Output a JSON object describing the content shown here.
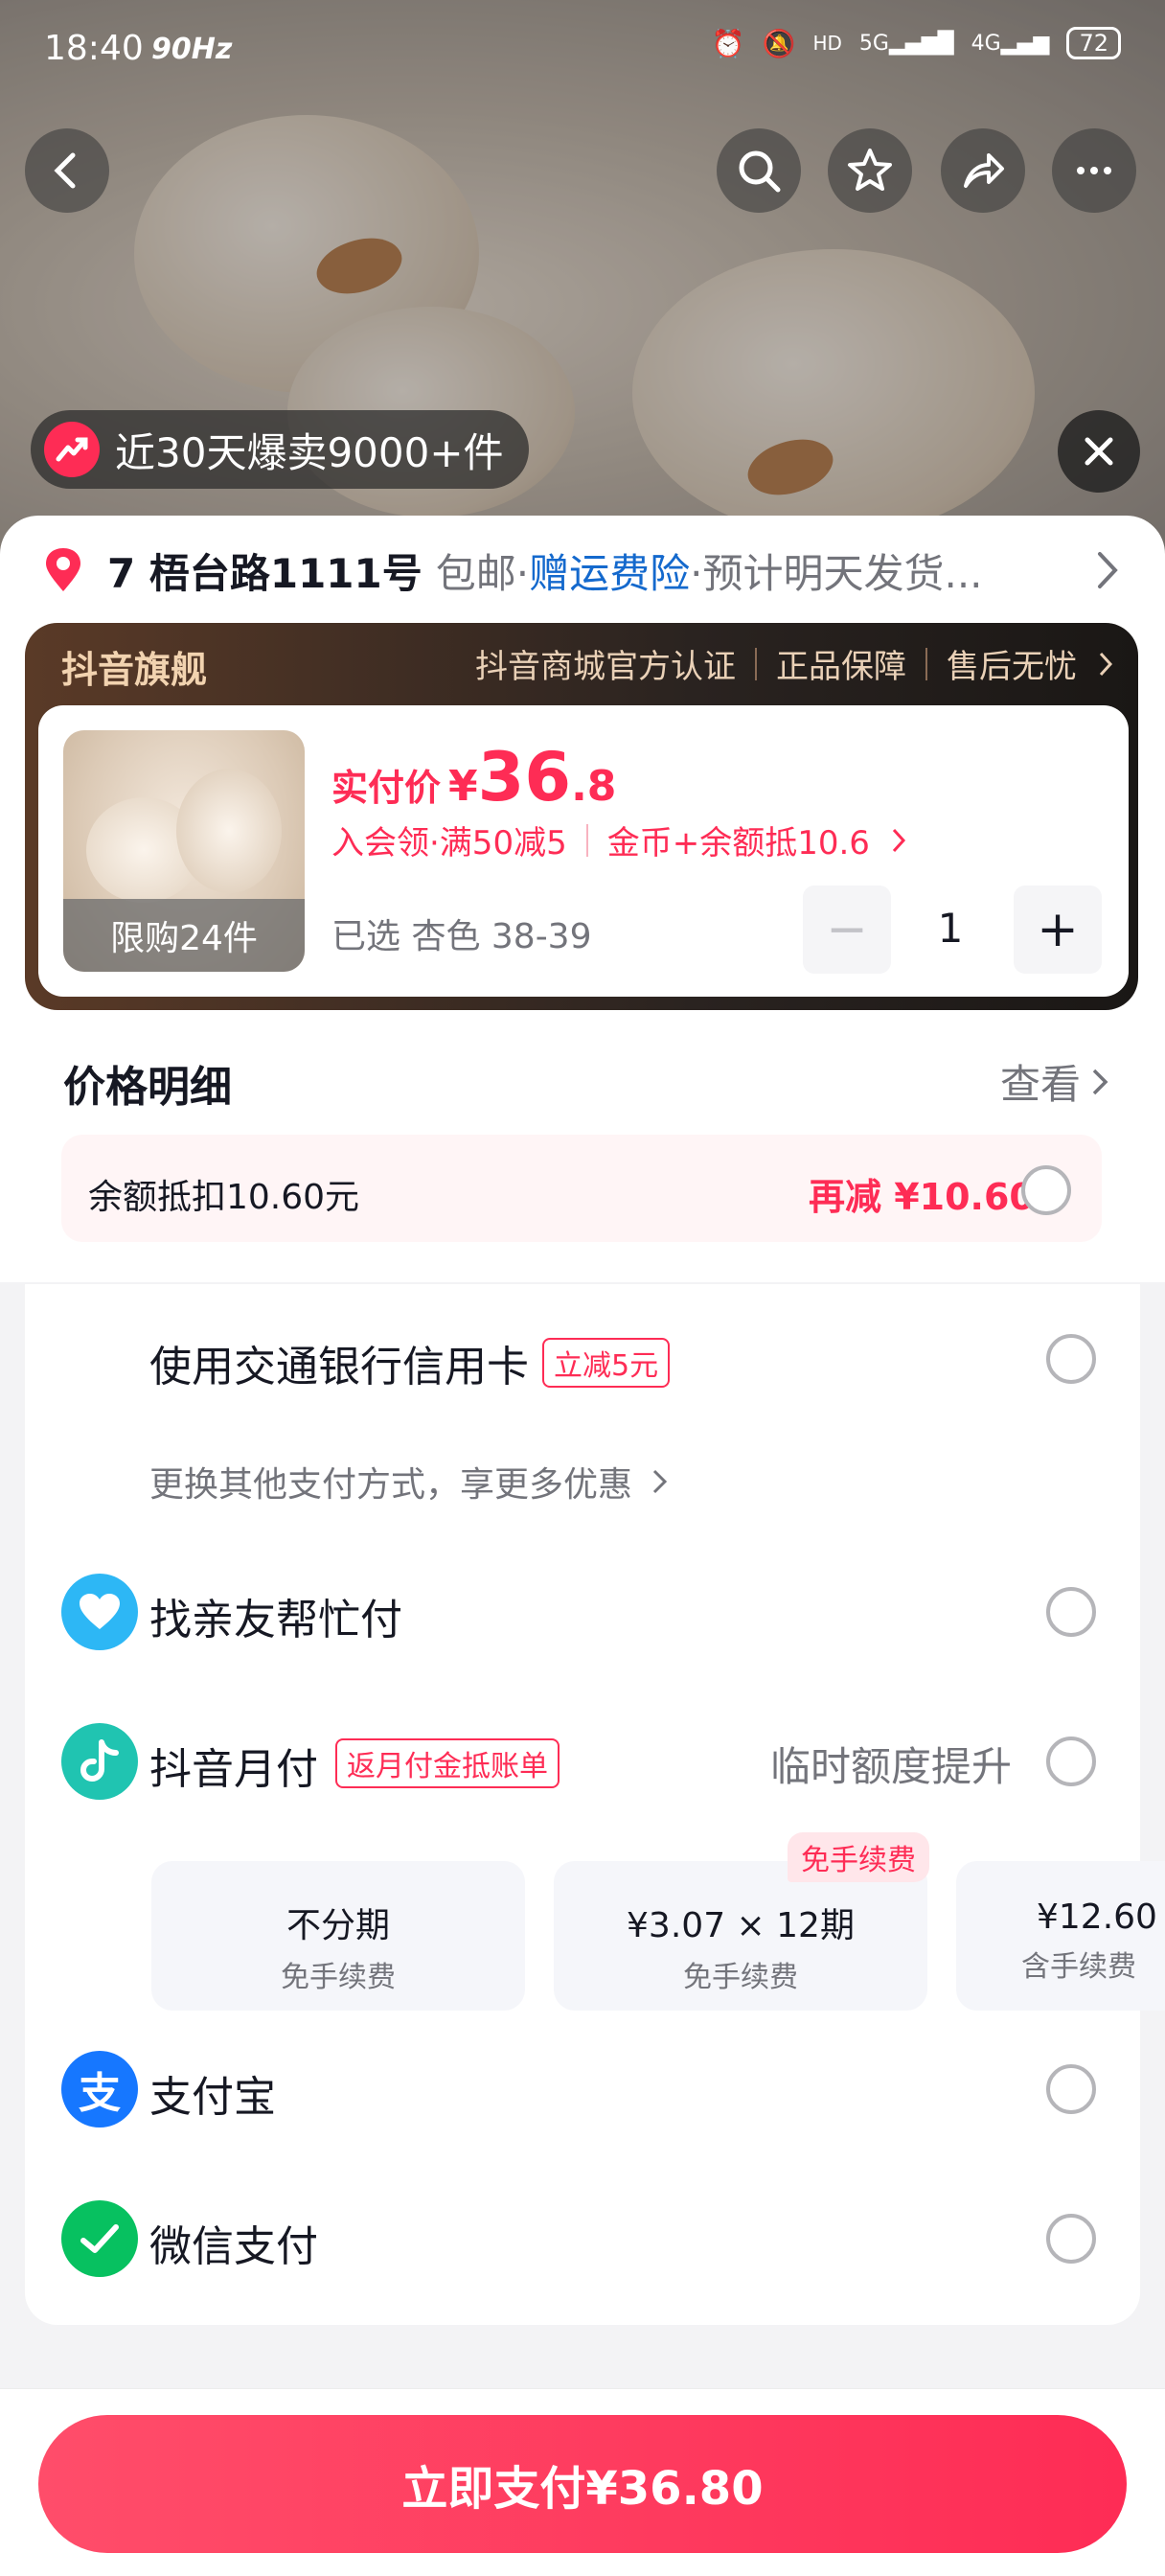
{
  "status_bar": {
    "time": "18:40",
    "refresh": "90Hz",
    "battery": "72"
  },
  "hero": {
    "hot_text": "近30天爆卖9000+件"
  },
  "address": {
    "line": "7  梧台路1111号",
    "shipping": "包邮·",
    "insurance": "赠运费险",
    "eta": "·预计明天发货..."
  },
  "store": {
    "title": "抖音旗舰",
    "badges": [
      "抖音商城官方认证",
      "正品保障",
      "售后无忧"
    ]
  },
  "product": {
    "limit": "限购24件",
    "price_label": "实付价",
    "currency": "¥",
    "price_int": "36",
    "price_dec": ".8",
    "promo_member": "入会领·满50减5",
    "promo_coin": "金币+余额抵10.6",
    "spec": "已选 杏色 38-39",
    "quantity": "1",
    "minus": "−",
    "plus": "+"
  },
  "price_detail": {
    "title": "价格明细",
    "view": "查看",
    "balance_label": "余额抵扣10.60元",
    "balance_value": "再减 ¥10.60"
  },
  "payment": {
    "bank_card": "使用交通银行信用卡",
    "bank_tag": "立减5元",
    "switch_hint": "更换其他支付方式，享更多优惠",
    "friend_pay": "找亲友帮忙付",
    "monthly": "抖音月付",
    "monthly_tag": "返月付金抵账单",
    "monthly_right": "临时额度提升",
    "installments": [
      {
        "title": "不分期",
        "sub": "免手续费"
      },
      {
        "title": "¥3.07 × 12期",
        "sub": "免手续费",
        "badge": "免手续费"
      },
      {
        "title": "¥12.60",
        "sub": "含手续费"
      }
    ],
    "alipay": "支付宝",
    "wechat": "微信支付"
  },
  "pay_button": "立即支付¥36.80",
  "colors": {
    "accent": "#fe2c55",
    "blue": "#1469cd",
    "alipay": "#1677ff",
    "wechat": "#07c160",
    "douyin_pay": "#20c4b1"
  }
}
